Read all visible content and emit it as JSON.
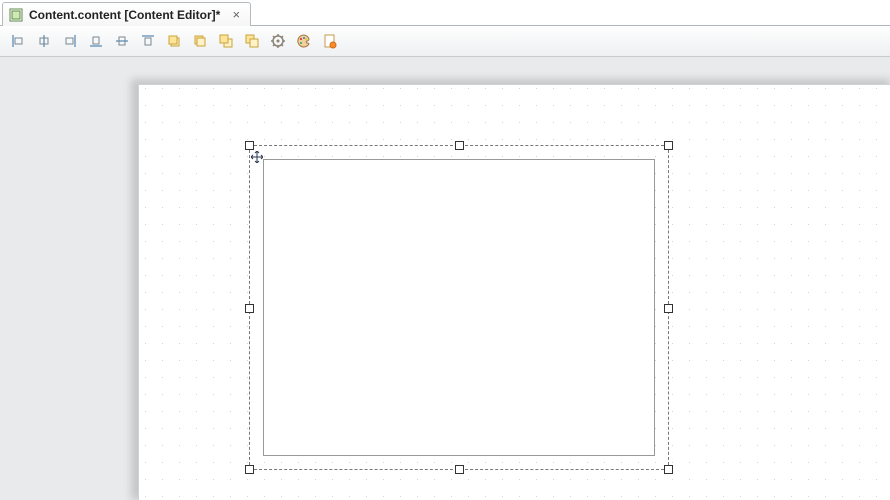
{
  "tab": {
    "title": "Content.content [Content Editor]*"
  },
  "toolbar": {
    "buttons": [
      {
        "name": "align-left"
      },
      {
        "name": "align-horizontal-center"
      },
      {
        "name": "align-right"
      },
      {
        "name": "align-bottom"
      },
      {
        "name": "align-vertical-center"
      },
      {
        "name": "align-top"
      },
      {
        "name": "bring-forward"
      },
      {
        "name": "send-backward"
      },
      {
        "name": "bring-to-front"
      },
      {
        "name": "send-to-back"
      },
      {
        "name": "settings"
      },
      {
        "name": "color-palette"
      },
      {
        "name": "page-style"
      }
    ]
  },
  "canvas": {
    "selection_present": true,
    "inner_panel_present": true
  }
}
